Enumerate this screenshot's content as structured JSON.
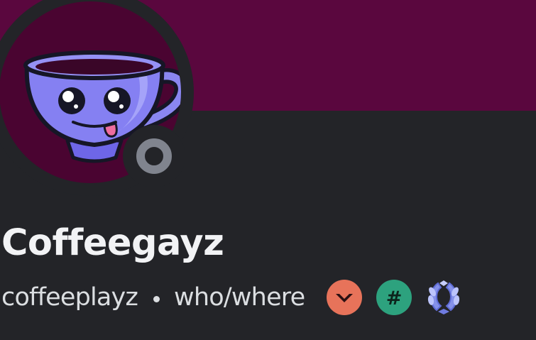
{
  "colors": {
    "banner": "#5a073e",
    "card_background": "#232428",
    "status_offline": "#80848e",
    "text_primary": "#f2f3f5",
    "text_secondary": "#dbdee1",
    "badge_hypesquad": "#e7735a",
    "badge_hash": "#2da27e",
    "badge_laurel": "#8591e9"
  },
  "avatar": {
    "icon": "teacup-mascot-avatar"
  },
  "status": {
    "icon": "offline-status-icon"
  },
  "profile": {
    "display_name": "Coffeegayz",
    "username": "coffeeplayz",
    "pronouns": "who/where"
  },
  "badges": [
    {
      "icon": "orange-chevron-badge-icon"
    },
    {
      "icon": "green-hashtag-badge-icon"
    },
    {
      "icon": "laurel-wreath-badge-icon"
    }
  ]
}
